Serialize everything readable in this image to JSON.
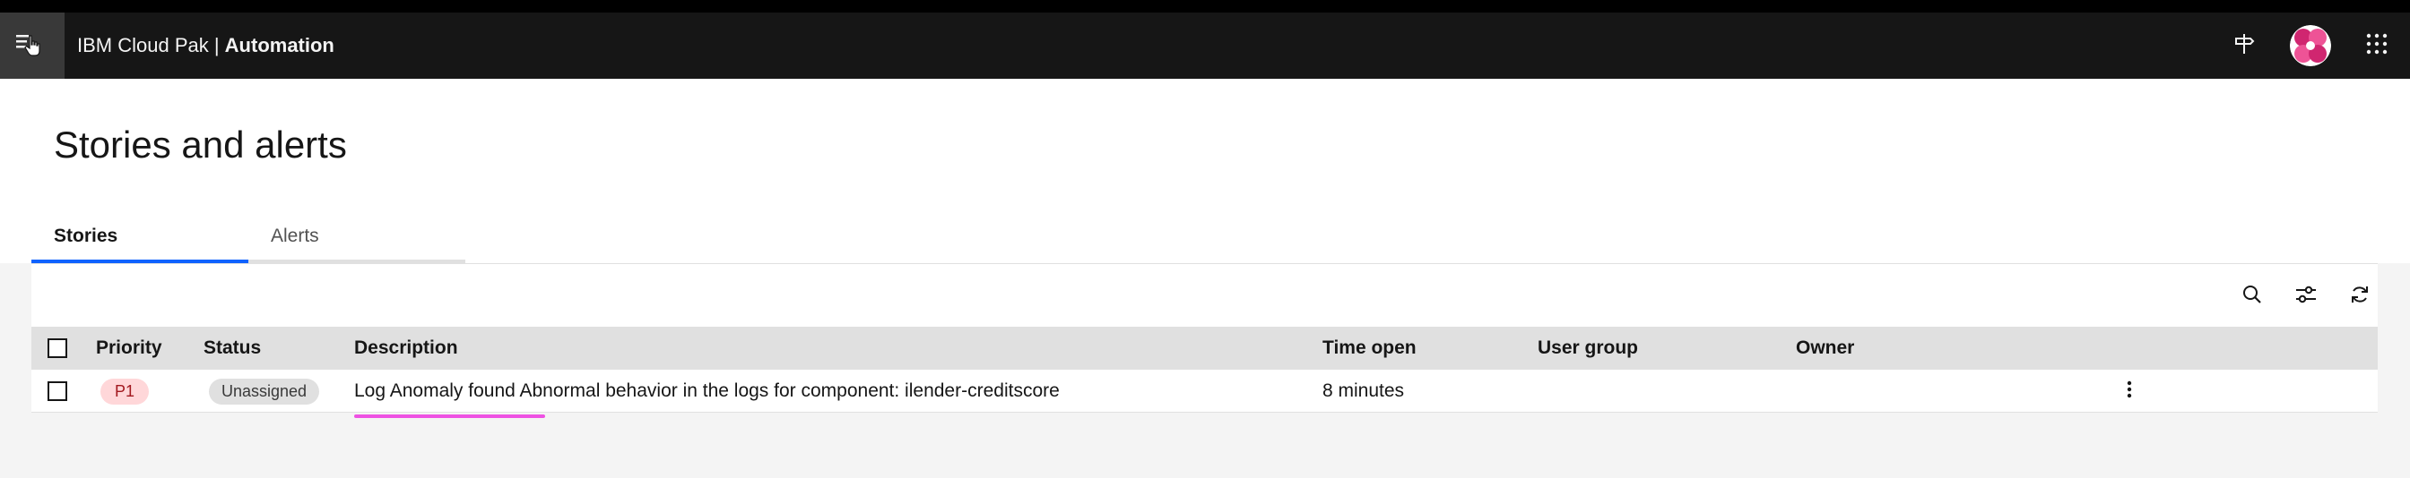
{
  "header": {
    "brand_prefix": "IBM Cloud Pak | ",
    "brand_product": "Automation",
    "icons": [
      "menu-hand-cursor-icon",
      "signpost-icon",
      "avatar",
      "app-switcher-grid-icon"
    ],
    "bg_color": "#161616"
  },
  "page": {
    "title": "Stories and alerts"
  },
  "tabs": [
    {
      "label": "Stories",
      "active": true
    },
    {
      "label": "Alerts",
      "active": false
    }
  ],
  "toolbar": {
    "icons": [
      "search-icon",
      "filter-settings-icon",
      "refresh-icon"
    ]
  },
  "table": {
    "columns": {
      "priority": "Priority",
      "status": "Status",
      "description": "Description",
      "time_open": "Time open",
      "user_group": "User group",
      "owner": "Owner"
    },
    "rows": [
      {
        "priority": "P1",
        "status": "Unassigned",
        "description": "Log Anomaly found Abnormal behavior in the logs for component: ilender-creditscore",
        "time_open": "8 minutes",
        "user_group": "",
        "owner": ""
      }
    ]
  },
  "colors": {
    "accent": "#0f62fe",
    "priority_bg": "#ffd7d9",
    "priority_fg": "#a2191f",
    "highlight": "#ee52e3"
  }
}
